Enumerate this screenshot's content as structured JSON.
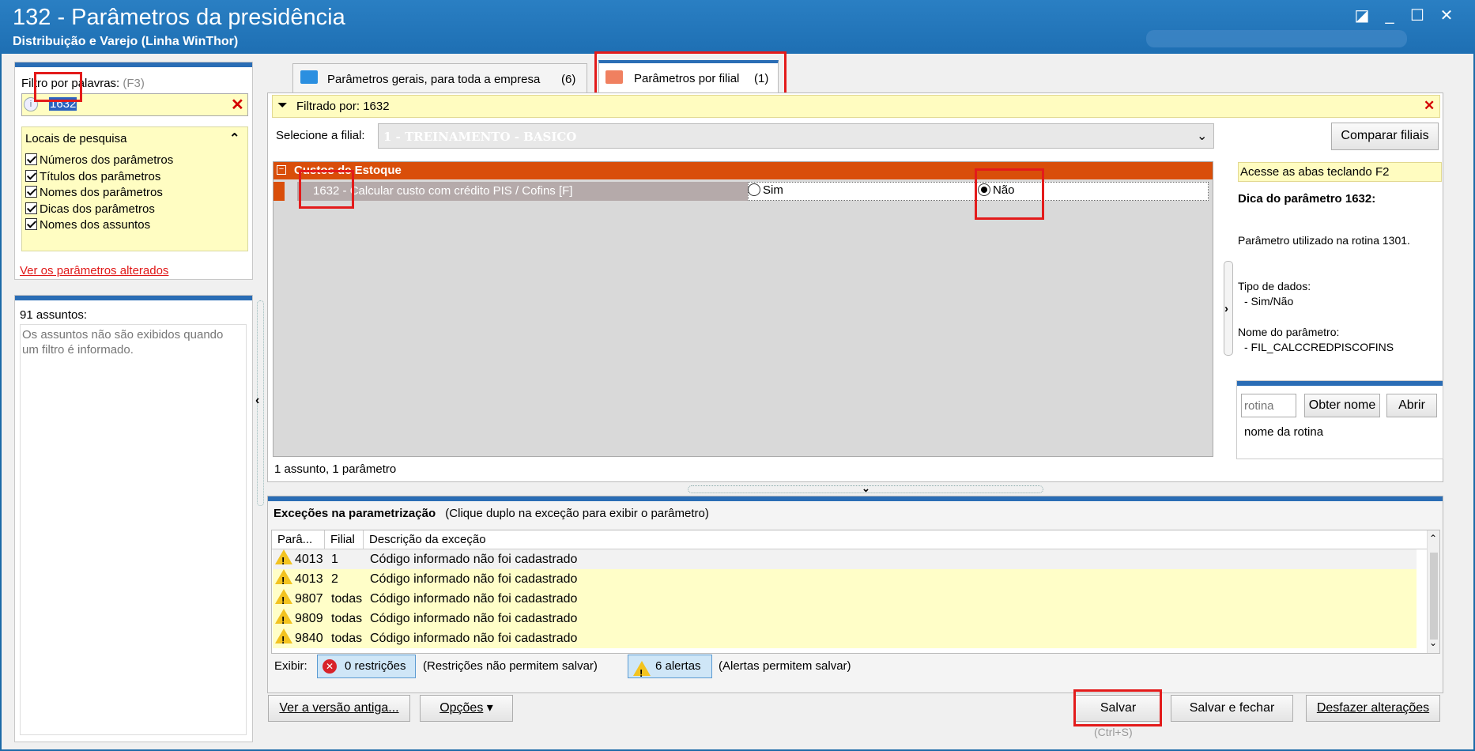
{
  "window": {
    "title": "132 - Parâmetros da presidência",
    "subtitle": "Distribuição e Varejo (Linha WinThor)"
  },
  "left": {
    "filter_label": "Filtro por palavras:",
    "filter_hint": "(F3)",
    "filter_value": "1632",
    "locais_title": "Locais de pesquisa",
    "checkboxes": [
      "Números dos parâmetros",
      "Títulos dos parâmetros",
      "Nomes dos parâmetros",
      "Dicas dos parâmetros",
      "Nomes dos assuntos"
    ],
    "altered_link": "Ver os parâmetros alterados",
    "subjects_count": "91 assuntos:",
    "subjects_msg": "Os assuntos não são exibidos quando um filtro é informado."
  },
  "tabs": [
    {
      "label": "Parâmetros gerais, para toda a empresa",
      "count": "(6)"
    },
    {
      "label": "Parâmetros por filial",
      "count": "(1)"
    }
  ],
  "filter_bar": {
    "text": "Filtrado por: 1632"
  },
  "filial": {
    "label": "Selecione a filial:",
    "value": "1 - TREINAMENTO - BASICO",
    "compare_button": "Comparar filiais"
  },
  "group": {
    "title": "Custos de Estoque"
  },
  "param": {
    "number": "1632",
    "title": " - Calcular custo com crédito PIS / Cofins [F]",
    "opt_yes": "Sim",
    "opt_no": "Não",
    "selected": "Não"
  },
  "status": "1 assunto, 1 parâmetro",
  "hint": {
    "tab_tip": "Acesse as abas teclando F2",
    "title": "Dica do parâmetro 1632:",
    "usage": "Parâmetro utilizado na rotina 1301.",
    "type_label": "Tipo de dados:",
    "type_value": "- Sim/Não",
    "name_label": "Nome do parâmetro:",
    "name_value": "- FIL_CALCCREDPISCOFINS",
    "rotina_placeholder": "rotina",
    "obter_button": "Obter nome",
    "abrir_button": "Abrir",
    "rotina_name": "nome da rotina"
  },
  "exceptions": {
    "title": "Exceções na parametrização",
    "subtitle": "(Clique duplo na exceção para exibir o parâmetro)",
    "columns": [
      "Parâ...",
      "Filial",
      "Descrição da exceção"
    ],
    "rows": [
      {
        "param": "4013",
        "filial": "1",
        "desc": "Código informado não foi cadastrado"
      },
      {
        "param": "4013",
        "filial": "2",
        "desc": "Código informado não foi cadastrado"
      },
      {
        "param": "9807",
        "filial": "todas",
        "desc": "Código informado não foi cadastrado"
      },
      {
        "param": "9809",
        "filial": "todas",
        "desc": "Código informado não foi cadastrado"
      },
      {
        "param": "9840",
        "filial": "todas",
        "desc": "Código informado não foi cadastrado"
      }
    ],
    "show_label": "Exibir:",
    "restrictions_btn": "0 restrições",
    "restrictions_note": "(Restrições não permitem salvar)",
    "alerts_btn": "6 alertas",
    "alerts_note": "(Alertas permitem salvar)"
  },
  "footer": {
    "old_version": "Ver a versão antiga...",
    "options": "Opções",
    "save": "Salvar",
    "save_shortcut": "(Ctrl+S)",
    "save_close": "Salvar e fechar",
    "undo": "Desfazer alterações"
  }
}
